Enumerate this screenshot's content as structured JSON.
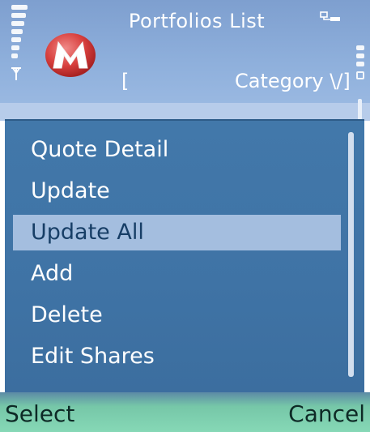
{
  "status_bar": {
    "title": "Portfolios List",
    "bracket": "[",
    "category_label": "Category \\/]",
    "signal_icon": "signal-strength-icon",
    "battery_icon": "battery-level-icon",
    "network_icon": "network-data-icon"
  },
  "menu": {
    "selected_index": 2,
    "items": [
      {
        "label": "Quote Detail"
      },
      {
        "label": "Update"
      },
      {
        "label": "Update All"
      },
      {
        "label": "Add"
      },
      {
        "label": "Delete"
      },
      {
        "label": "Edit Shares"
      }
    ]
  },
  "softkeys": {
    "left": "Select",
    "right": "Cancel"
  },
  "colors": {
    "menu_background": "#3f73a5",
    "menu_highlight": "#a4bedf",
    "softkey_background": "#86d8b6",
    "title_background": "#8fb0dc"
  }
}
